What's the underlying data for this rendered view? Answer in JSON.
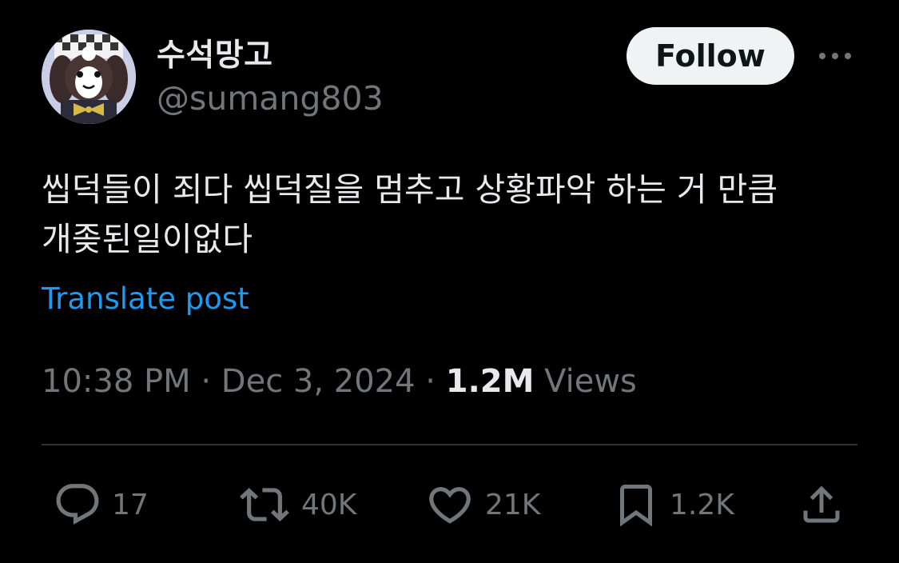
{
  "user": {
    "display_name": "수석망고",
    "handle": "@sumang803"
  },
  "follow_label": "Follow",
  "tweet": {
    "text": "씹덕들이 죄다 씹덕질을 멈추고 상황파악 하는 거 만큼 개좆된일이없다",
    "translate_label": "Translate post",
    "time": "10:38 PM",
    "separator": " · ",
    "date": "Dec 3, 2024",
    "views_count": "1.2M",
    "views_label": "Views"
  },
  "actions": {
    "reply": {
      "icon": "reply-icon",
      "count": "17"
    },
    "retweet": {
      "icon": "retweet-icon",
      "count": "40K"
    },
    "like": {
      "icon": "heart-icon",
      "count": "21K"
    },
    "bookmark": {
      "icon": "bookmark-icon",
      "count": "1.2K"
    },
    "share": {
      "icon": "share-icon"
    }
  },
  "colors": {
    "background": "#000000",
    "text_primary": "#e7e9ea",
    "text_secondary": "#71767b",
    "link": "#1d9bf0",
    "follow_bg": "#eff3f4",
    "divider": "#2f3336"
  }
}
